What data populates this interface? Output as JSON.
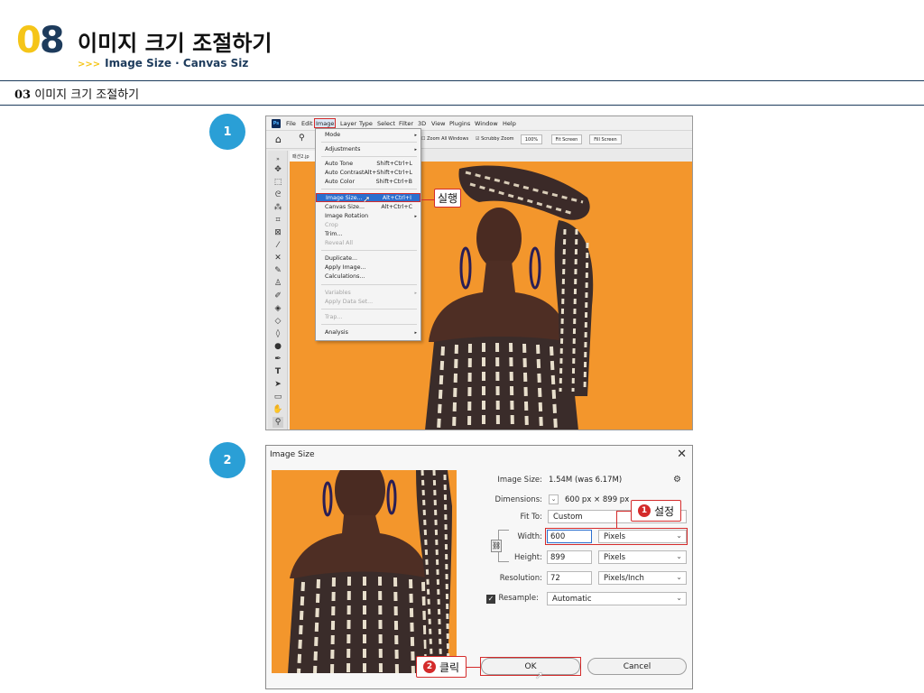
{
  "header": {
    "chapter_digit0": "0",
    "chapter_digit1": "8",
    "title": "이미지 크기 조절하기",
    "subtitle_arrows": ">>>",
    "subtitle": "Image Size · Canvas Siz",
    "section_num": "03",
    "section_title": "이미지 크기 조절하기"
  },
  "steps": [
    "1",
    "2"
  ],
  "photoshop": {
    "logo": "Ps",
    "menus": [
      "File",
      "Edit",
      "Image",
      "Layer",
      "Type",
      "Select",
      "Filter",
      "3D",
      "View",
      "Plugins",
      "Window",
      "Help"
    ],
    "options": {
      "zoom_all": "Zoom All Windows",
      "scrubby": "Scrubby Zoom",
      "zoom_pct": "100%",
      "fit_screen": "Fit Screen",
      "fill_screen": "Fill Screen"
    },
    "doc_tab": "패션2.jp",
    "image_menu": {
      "mode": "Mode",
      "adjustments": "Adjustments",
      "auto_tone": "Auto Tone",
      "auto_tone_sc": "Shift+Ctrl+L",
      "auto_contrast": "Auto Contrast",
      "auto_contrast_sc": "Alt+Shift+Ctrl+L",
      "auto_color": "Auto Color",
      "auto_color_sc": "Shift+Ctrl+B",
      "image_size": "Image Size...",
      "image_size_sc": "Alt+Ctrl+I",
      "canvas_size": "Canvas Size...",
      "canvas_size_sc": "Alt+Ctrl+C",
      "image_rotation": "Image Rotation",
      "crop": "Crop",
      "trim": "Trim...",
      "reveal_all": "Reveal All",
      "duplicate": "Duplicate...",
      "apply_image": "Apply Image...",
      "calculations": "Calculations...",
      "variables": "Variables",
      "apply_data_set": "Apply Data Set...",
      "trap": "Trap...",
      "analysis": "Analysis"
    },
    "callout": "실행"
  },
  "dialog": {
    "title": "Image Size",
    "image_size_label": "Image Size:",
    "image_size_value": "1.54M (was 6.17M)",
    "dimensions_label": "Dimensions:",
    "dimensions_value": "600 px × 899 px",
    "fit_to_label": "Fit To:",
    "fit_to_value": "Custom",
    "width_label": "Width:",
    "width_value": "600",
    "width_unit": "Pixels",
    "height_label": "Height:",
    "height_value": "899",
    "height_unit": "Pixels",
    "resolution_label": "Resolution:",
    "resolution_value": "72",
    "resolution_unit": "Pixels/Inch",
    "resample_label": "Resample:",
    "resample_value": "Automatic",
    "ok": "OK",
    "cancel": "Cancel",
    "callout1_num": "1",
    "callout1": "설정",
    "callout2_num": "2",
    "callout2": "클릭"
  }
}
